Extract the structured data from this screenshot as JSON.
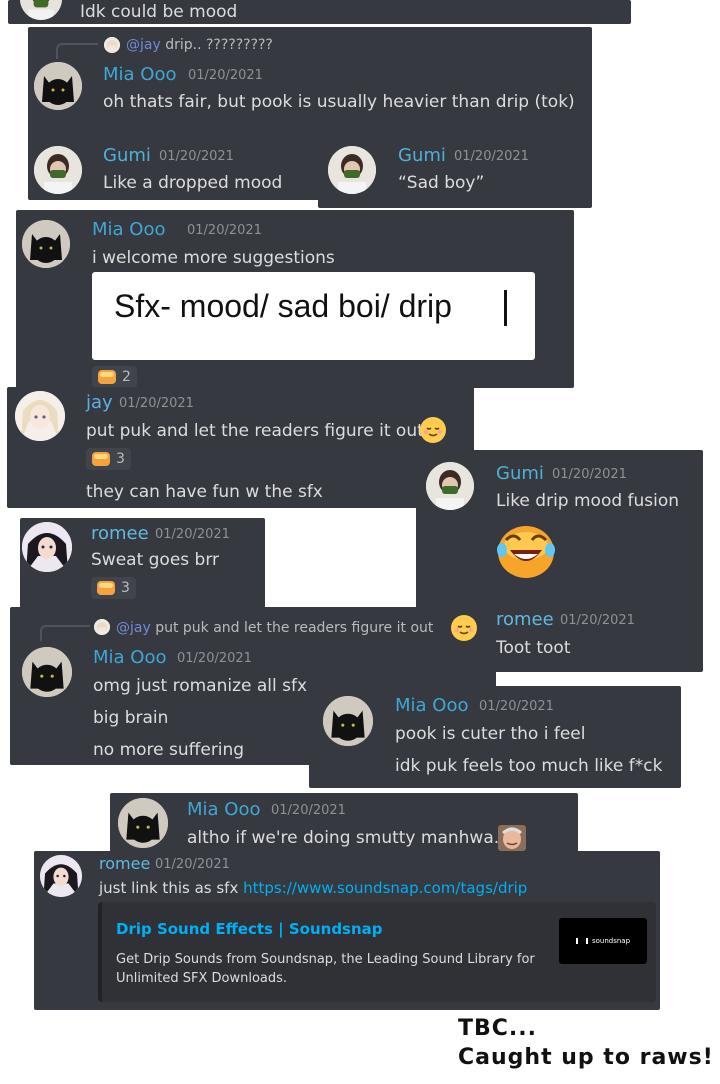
{
  "colors": {
    "panel_bg": "#36393f",
    "text": "#dcddde",
    "timestamp": "#8e9297",
    "link": "#00aff4",
    "mention": "#7289da",
    "mia": "#3fa7d6",
    "gumi": "#4fb0d8",
    "jay": "#5ab0e8",
    "romee": "#5fb9e0"
  },
  "icons": {
    "cat_avatar": "black-cat-avatar",
    "gumi_avatar": "masked-person-avatar",
    "jay_avatar": "anime-girl-avatar",
    "romee_avatar": "dark-hair-girl-avatar",
    "reaction": "hands-emoji",
    "relieved": "relieved-face-emoji",
    "crying_laugh": "laughing-crying-emoji"
  },
  "p0": {
    "msg": "Idk could be mood"
  },
  "p1": {
    "reply_mention": "@jay",
    "reply_text": " drip.. ?????????",
    "m1": {
      "name": "Mia Ooo",
      "ts": "01/20/2021",
      "text": "oh  thats fair, but pook is usually heavier than drip (tok)"
    },
    "m2": {
      "name": "Gumi",
      "ts": "01/20/2021",
      "text": "Like a dropped mood"
    },
    "m3": {
      "name": "Gumi",
      "ts": "01/20/2021",
      "text": "“Sad boy”"
    }
  },
  "p2": {
    "name": "Mia Ooo",
    "ts": "01/20/2021",
    "text": "i  welcome more suggestions",
    "image_text": "Sfx- mood/ sad boi/ drip",
    "reaction_count": "2"
  },
  "p3": {
    "name": "jay",
    "ts": "01/20/2021",
    "text": "put puk and let the readers figure it out",
    "reaction_count": "3",
    "text2": "they can have fun w the sfx"
  },
  "p4": {
    "name": "Gumi",
    "ts": "01/20/2021",
    "text": "Like drip mood fusion",
    "name2": "romee",
    "ts2": "01/20/2021",
    "text2": "Toot toot"
  },
  "p5": {
    "name": "romee",
    "ts": "01/20/2021",
    "text": "Sweat goes brr",
    "reaction_count": "3"
  },
  "p6": {
    "reply_mention": "@jay",
    "reply_text": " put puk and let the readers figure it out",
    "name": "Mia Ooo",
    "ts": "01/20/2021",
    "l1": "omg just romanize all sfx",
    "l2": "big brain",
    "l3": "no more suffering"
  },
  "p7": {
    "name": "Mia Ooo",
    "ts": "01/20/2021",
    "l1": "pook is cuter tho i feel",
    "l2": "idk puk feels too much like f*ck"
  },
  "p8": {
    "name": "Mia Ooo",
    "ts": "01/20/2021",
    "text": "altho if we're doing smutty manhwa..."
  },
  "p9": {
    "name": "romee",
    "ts": "01/20/2021",
    "text_prefix": "just link this as sfx ",
    "url": "https://www.soundsnap.com/tags/drip",
    "embed_title": "Drip Sound Effects | Soundsnap",
    "embed_desc1": "Get Drip Sounds from Soundsnap, the Leading Sound Library for",
    "embed_desc2": "Unlimited SFX Downloads.",
    "embed_logo": "soundsnap"
  },
  "caption": {
    "l1": "TBC...",
    "l2": "Caught up to raws!"
  }
}
